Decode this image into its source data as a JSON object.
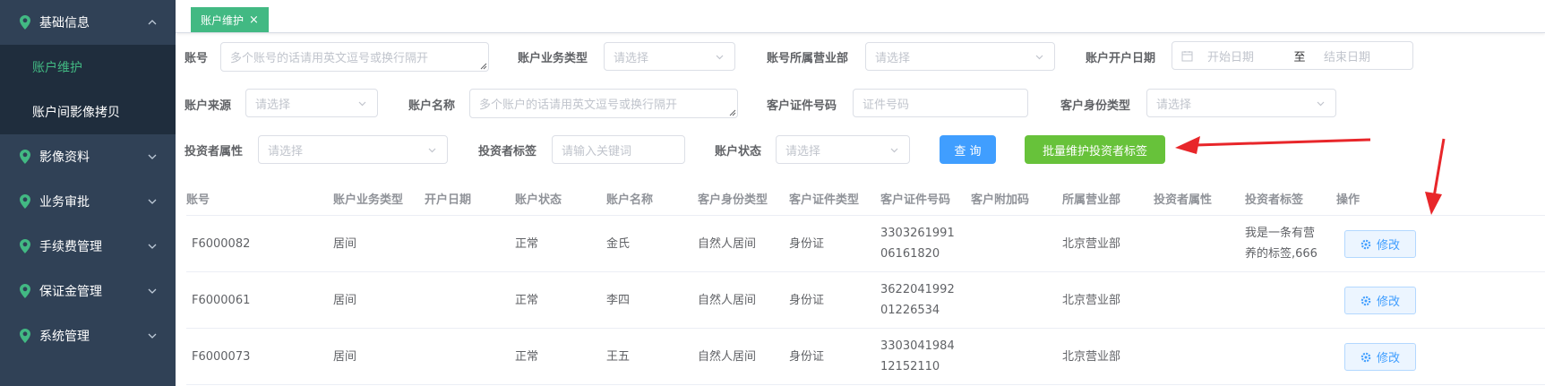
{
  "sidebar": {
    "items": [
      {
        "label": "基础信息",
        "open": true
      },
      {
        "label": "影像资料"
      },
      {
        "label": "业务审批"
      },
      {
        "label": "手续费管理"
      },
      {
        "label": "保证金管理"
      },
      {
        "label": "系统管理"
      }
    ],
    "subitems": [
      {
        "label": "账户维护",
        "active": true
      },
      {
        "label": "账户间影像拷贝"
      }
    ],
    "accent_color": "#42b983"
  },
  "tab": {
    "label": "账户维护",
    "close": "×"
  },
  "filters": {
    "account": {
      "label": "账号",
      "placeholder": "多个账号的话请用英文逗号或换行隔开"
    },
    "biz_type": {
      "label": "账户业务类型",
      "placeholder": "请选择"
    },
    "branch": {
      "label": "账号所属营业部",
      "placeholder": "请选择"
    },
    "open_date": {
      "label": "账户开户日期",
      "start": "开始日期",
      "sep": "至",
      "end": "结束日期"
    },
    "source": {
      "label": "账户来源",
      "placeholder": "请选择"
    },
    "acct_name": {
      "label": "账户名称",
      "placeholder": "多个账户的话请用英文逗号或换行隔开"
    },
    "id_no": {
      "label": "客户证件号码",
      "placeholder": "证件号码"
    },
    "id_type": {
      "label": "客户身份类型",
      "placeholder": "请选择"
    },
    "investor_attr": {
      "label": "投资者属性",
      "placeholder": "请选择"
    },
    "investor_tag": {
      "label": "投资者标签",
      "placeholder": "请输入关键词"
    },
    "status": {
      "label": "账户状态",
      "placeholder": "请选择"
    }
  },
  "buttons": {
    "query": "查 询",
    "batch": "批量维护投资者标签"
  },
  "table": {
    "headers": [
      "账号",
      "账户业务类型",
      "开户日期",
      "账户状态",
      "账户名称",
      "客户身份类型",
      "客户证件类型",
      "客户证件号码",
      "客户附加码",
      "所属营业部",
      "投资者属性",
      "投资者标签",
      "操作"
    ],
    "rows": [
      {
        "account": "F6000082",
        "biz": "居间",
        "date": "",
        "status": "正常",
        "name": "金氏",
        "id_type": "自然人居间",
        "cert_type": "身份证",
        "cert_no": "330326199106161820",
        "extra": "",
        "branch": "北京营业部",
        "attr": "",
        "tag": "我是一条有营养的标签,666",
        "action": "修改"
      },
      {
        "account": "F6000061",
        "biz": "居间",
        "date": "",
        "status": "正常",
        "name": "李四",
        "id_type": "自然人居间",
        "cert_type": "身份证",
        "cert_no": "362204199201226534",
        "extra": "",
        "branch": "北京营业部",
        "attr": "",
        "tag": "",
        "action": "修改"
      },
      {
        "account": "F6000073",
        "biz": "居间",
        "date": "",
        "status": "正常",
        "name": "王五",
        "id_type": "自然人居间",
        "cert_type": "身份证",
        "cert_no": "330304198412152110",
        "extra": "",
        "branch": "北京营业部",
        "attr": "",
        "tag": "",
        "action": "修改"
      }
    ]
  },
  "colors": {
    "primary": "#409eff",
    "success": "#67c23a",
    "annotation": "#e8262a",
    "sidebar_bg": "#304156"
  }
}
